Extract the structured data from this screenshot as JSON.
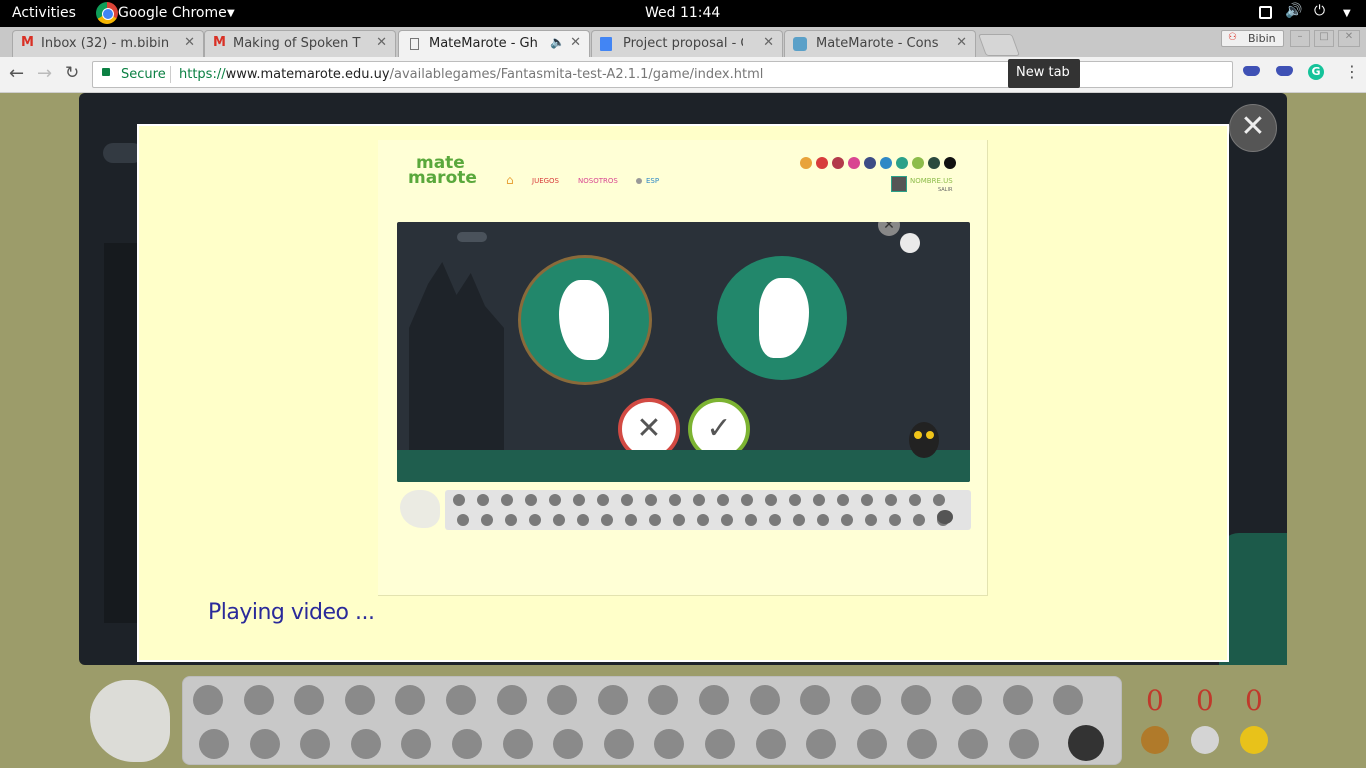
{
  "system_bar": {
    "activities": "Activities",
    "app_name": "Google Chrome",
    "clock": "Wed 11:44"
  },
  "tabs": [
    {
      "label": "Inbox (32) - m.bibin",
      "icon": "gmail-icon"
    },
    {
      "label": "Making of Spoken T",
      "icon": "gmail-icon"
    },
    {
      "label": "MateMarote - Gh",
      "icon": "page-icon",
      "active": true
    },
    {
      "label": "Project proposal - G",
      "icon": "docs-icon"
    },
    {
      "label": "MateMarote - Cons",
      "icon": "matemarote-icon"
    }
  ],
  "tooltip": "New tab",
  "window_extension_label": "Bibin",
  "address_bar": {
    "secure_label": "Secure",
    "url_scheme": "https://",
    "url_host": "www.matemarote.edu.uy",
    "url_path": "/availablegames/Fantasmita-test-A2.1.1/game/index.html"
  },
  "site": {
    "logo_line1": "mate",
    "logo_line2": "marote",
    "nav_games": "JUEGOS",
    "nav_about": "NOSOTROS",
    "nav_lang": "ESP",
    "user_name": "NOMBRE.US",
    "user_logout": "SALIR",
    "palette": [
      "#e8a33a",
      "#d83c3c",
      "#b33a4a",
      "#d94691",
      "#3d4c86",
      "#2f89c6",
      "#2aa189",
      "#8dbc4a",
      "#2b4a3e",
      "#111111"
    ]
  },
  "modal": {
    "status_text": "Playing video ..."
  },
  "scores": {
    "bronze": "0",
    "silver": "0",
    "gold": "0"
  },
  "colors": {
    "modal_bg": "#ffffc9",
    "stage_bg": "#1d2228",
    "ghost_circle": "#22876b",
    "wrong_ring": "#d24a43",
    "right_ring": "#7cb332"
  }
}
